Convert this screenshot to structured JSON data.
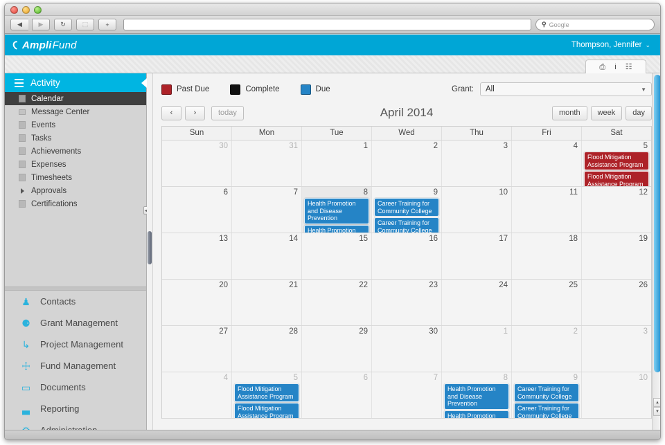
{
  "browser": {
    "back_label": "◀",
    "forward_label": "▶",
    "reload_label": "↻",
    "snapshot_label": "⬚",
    "newtab_label": "+",
    "url_value": "",
    "search_placeholder": "Google",
    "search_icon": "search-icon"
  },
  "app": {
    "brand_prefix": "Ampli",
    "brand_suffix": "Fund",
    "brand_color": "#00a6d6",
    "user_name": "Thompson, Jennifer",
    "user_caret": "⌄"
  },
  "tabchip": {
    "icons": [
      {
        "name": "print-icon",
        "glyph": "⎙"
      },
      {
        "name": "info-icon",
        "glyph": "i"
      },
      {
        "name": "table-icon",
        "glyph": "☷"
      }
    ]
  },
  "sidebar": {
    "section_title": "Activity",
    "items": [
      {
        "label": "Calendar",
        "icon": "calendar-icon",
        "active": true
      },
      {
        "label": "Message Center",
        "icon": "message-icon",
        "active": false
      },
      {
        "label": "Events",
        "icon": "list-icon",
        "active": false
      },
      {
        "label": "Tasks",
        "icon": "list-icon",
        "active": false
      },
      {
        "label": "Achievements",
        "icon": "list-icon",
        "active": false
      },
      {
        "label": "Expenses",
        "icon": "list-icon",
        "active": false
      },
      {
        "label": "Timesheets",
        "icon": "list-icon",
        "active": false
      },
      {
        "label": "Approvals",
        "icon": "expand-triangle-icon",
        "active": false
      },
      {
        "label": "Certifications",
        "icon": "list-icon",
        "active": false
      }
    ],
    "nav": [
      {
        "label": "Contacts",
        "icon": "person-icon",
        "glyph": "♟"
      },
      {
        "label": "Grant Management",
        "icon": "money-bag-icon",
        "glyph": "⚈"
      },
      {
        "label": "Project Management",
        "icon": "project-tree-icon",
        "glyph": "↳"
      },
      {
        "label": "Fund Management",
        "icon": "thermometer-icon",
        "glyph": "☩"
      },
      {
        "label": "Documents",
        "icon": "folder-icon",
        "glyph": "▭"
      },
      {
        "label": "Reporting",
        "icon": "bar-chart-icon",
        "glyph": "▃"
      },
      {
        "label": "Administration",
        "icon": "gear-icon",
        "glyph": "⚙"
      }
    ]
  },
  "toolbar": {
    "legend": [
      {
        "label": "Past Due",
        "color": "#ad2228"
      },
      {
        "label": "Complete",
        "color": "#111111"
      },
      {
        "label": "Due",
        "color": "#2584c6"
      }
    ],
    "grant_label": "Grant:",
    "grant_value": "All",
    "grant_caret": "▼",
    "prev_label": "‹",
    "next_label": "›",
    "today_label": "today",
    "views": [
      "month",
      "week",
      "day"
    ],
    "active_view": "month"
  },
  "calendar": {
    "title": "April 2014",
    "weekday_headers": [
      "Sun",
      "Mon",
      "Tue",
      "Wed",
      "Thu",
      "Fri",
      "Sat"
    ],
    "weeks": [
      [
        {
          "num": "30",
          "other": true,
          "today": false,
          "events": []
        },
        {
          "num": "31",
          "other": true,
          "today": false,
          "events": []
        },
        {
          "num": "1",
          "other": false,
          "today": false,
          "events": []
        },
        {
          "num": "2",
          "other": false,
          "today": false,
          "events": []
        },
        {
          "num": "3",
          "other": false,
          "today": false,
          "events": []
        },
        {
          "num": "4",
          "other": false,
          "today": false,
          "events": []
        },
        {
          "num": "5",
          "other": false,
          "today": false,
          "events": [
            {
              "title": "Flood Mitigation Assistance Program",
              "status": "pastdue"
            },
            {
              "title": "Flood Mitigation Assistance Program",
              "status": "pastdue"
            }
          ]
        }
      ],
      [
        {
          "num": "6",
          "other": false,
          "today": false,
          "events": []
        },
        {
          "num": "7",
          "other": false,
          "today": false,
          "events": []
        },
        {
          "num": "8",
          "other": false,
          "today": true,
          "events": [
            {
              "title": "Health Promotion and Disease Prevention",
              "status": "due"
            },
            {
              "title": "Health Promotion and Disease Prevention",
              "status": "due"
            }
          ]
        },
        {
          "num": "9",
          "other": false,
          "today": false,
          "events": [
            {
              "title": "Career Training for Community College",
              "status": "due"
            },
            {
              "title": "Career Training for Community College",
              "status": "due"
            }
          ]
        },
        {
          "num": "10",
          "other": false,
          "today": false,
          "events": []
        },
        {
          "num": "11",
          "other": false,
          "today": false,
          "events": []
        },
        {
          "num": "12",
          "other": false,
          "today": false,
          "events": []
        }
      ],
      [
        {
          "num": "13",
          "other": false,
          "today": false,
          "events": []
        },
        {
          "num": "14",
          "other": false,
          "today": false,
          "events": []
        },
        {
          "num": "15",
          "other": false,
          "today": false,
          "events": []
        },
        {
          "num": "16",
          "other": false,
          "today": false,
          "events": []
        },
        {
          "num": "17",
          "other": false,
          "today": false,
          "events": []
        },
        {
          "num": "18",
          "other": false,
          "today": false,
          "events": []
        },
        {
          "num": "19",
          "other": false,
          "today": false,
          "events": []
        }
      ],
      [
        {
          "num": "20",
          "other": false,
          "today": false,
          "events": []
        },
        {
          "num": "21",
          "other": false,
          "today": false,
          "events": []
        },
        {
          "num": "22",
          "other": false,
          "today": false,
          "events": []
        },
        {
          "num": "23",
          "other": false,
          "today": false,
          "events": []
        },
        {
          "num": "24",
          "other": false,
          "today": false,
          "events": []
        },
        {
          "num": "25",
          "other": false,
          "today": false,
          "events": []
        },
        {
          "num": "26",
          "other": false,
          "today": false,
          "events": []
        }
      ],
      [
        {
          "num": "27",
          "other": false,
          "today": false,
          "events": []
        },
        {
          "num": "28",
          "other": false,
          "today": false,
          "events": []
        },
        {
          "num": "29",
          "other": false,
          "today": false,
          "events": []
        },
        {
          "num": "30",
          "other": false,
          "today": false,
          "events": []
        },
        {
          "num": "1",
          "other": true,
          "today": false,
          "events": []
        },
        {
          "num": "2",
          "other": true,
          "today": false,
          "events": []
        },
        {
          "num": "3",
          "other": true,
          "today": false,
          "events": []
        }
      ],
      [
        {
          "num": "4",
          "other": true,
          "today": false,
          "events": []
        },
        {
          "num": "5",
          "other": true,
          "today": false,
          "events": [
            {
              "title": "Flood Mitigation Assistance Program",
              "status": "due"
            },
            {
              "title": "Flood Mitigation Assistance Program",
              "status": "due"
            }
          ]
        },
        {
          "num": "6",
          "other": true,
          "today": false,
          "events": []
        },
        {
          "num": "7",
          "other": true,
          "today": false,
          "events": []
        },
        {
          "num": "8",
          "other": true,
          "today": false,
          "events": [
            {
              "title": "Health Promotion and Disease Prevention",
              "status": "due"
            },
            {
              "title": "Health Promotion and Disease Prevention",
              "status": "due"
            }
          ]
        },
        {
          "num": "9",
          "other": true,
          "today": false,
          "events": [
            {
              "title": "Career Training for Community College",
              "status": "due"
            },
            {
              "title": "Career Training for Community College",
              "status": "due"
            }
          ]
        },
        {
          "num": "10",
          "other": true,
          "today": false,
          "events": []
        }
      ]
    ]
  }
}
